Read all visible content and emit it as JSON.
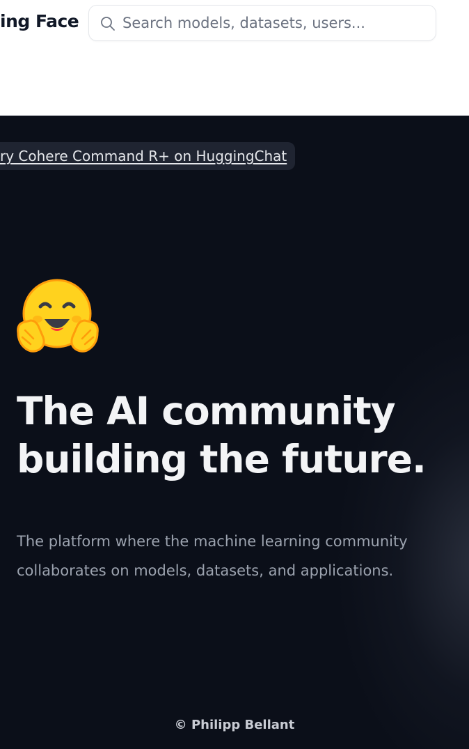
{
  "header": {
    "brand_text": "ing Face",
    "search": {
      "placeholder": "Search models, datasets, users...",
      "icon": "search-icon"
    }
  },
  "hero": {
    "announcement": "ry Cohere Command R+ on HuggingChat",
    "logo_icon": "hugging-face-emoji-icon",
    "headline_line1": "The AI community",
    "headline_line2": "building the future.",
    "subtitle_line1": "The platform where the machine learning community",
    "subtitle_line2": "collaborates on models, datasets, and applications."
  },
  "watermark": "© Philipp Bellant",
  "colors": {
    "hero_background": "#0b0f19",
    "headline": "#f3f4f6",
    "subtitle": "#9ca3af",
    "logo_yellow": "#ffd21e",
    "logo_orange": "#ff9d0b"
  }
}
